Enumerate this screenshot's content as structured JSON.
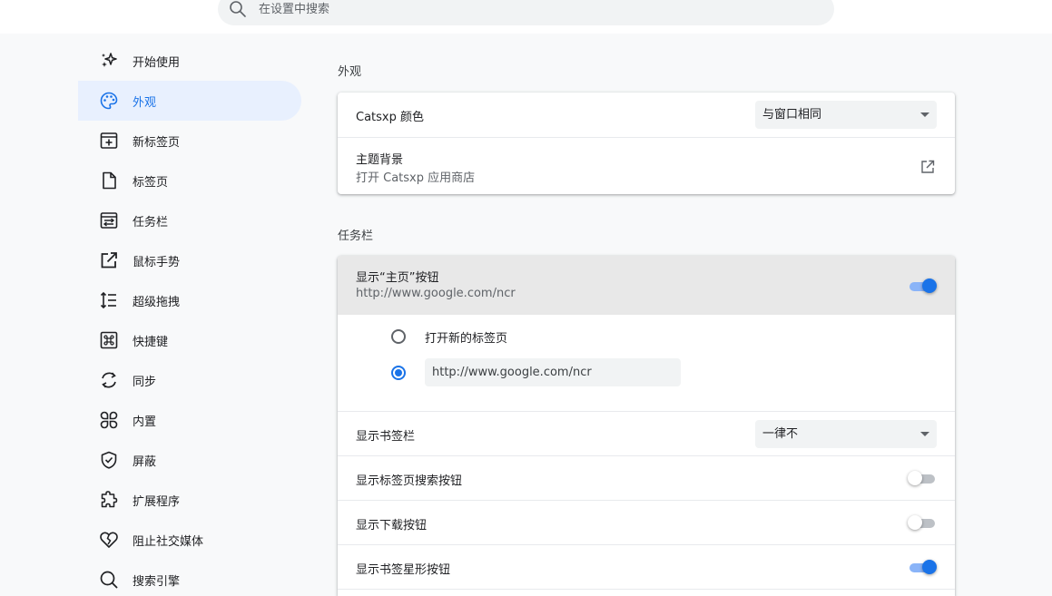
{
  "search": {
    "placeholder": "在设置中搜索"
  },
  "sidebar": {
    "items": [
      {
        "label": "开始使用",
        "icon": "sparkle-icon"
      },
      {
        "label": "外观",
        "icon": "palette-icon"
      },
      {
        "label": "新标签页",
        "icon": "new-tab-icon"
      },
      {
        "label": "标签页",
        "icon": "tab-page-icon"
      },
      {
        "label": "任务栏",
        "icon": "toolbar-icon"
      },
      {
        "label": "鼠标手势",
        "icon": "mouse-gesture-icon"
      },
      {
        "label": "超级拖拽",
        "icon": "super-drag-icon"
      },
      {
        "label": "快捷键",
        "icon": "shortcut-icon"
      },
      {
        "label": "同步",
        "icon": "sync-icon"
      },
      {
        "label": "内置",
        "icon": "builtin-icon"
      },
      {
        "label": "屏蔽",
        "icon": "shield-icon"
      },
      {
        "label": "扩展程序",
        "icon": "extension-icon"
      },
      {
        "label": "阻止社交媒体",
        "icon": "broken-heart-icon"
      },
      {
        "label": "搜索引擎",
        "icon": "search-icon"
      }
    ],
    "active_index": 1
  },
  "appearance": {
    "title": "外观",
    "color_label": "Catsxp 颜色",
    "color_value": "与窗口相同",
    "theme_label": "主题背景",
    "theme_sub": "打开 Catsxp 应用商店"
  },
  "toolbar": {
    "title": "任务栏",
    "home_label": "显示“主页”按钮",
    "home_sub": "http://www.google.com/ncr",
    "home_enabled": true,
    "radio_new_tab": "打开新的标签页",
    "radio_url_value": "http://www.google.com/ncr",
    "bookmarks_bar_label": "显示书签栏",
    "bookmarks_bar_value": "一律不",
    "tab_search_label": "显示标签页搜索按钮",
    "tab_search_enabled": false,
    "download_label": "显示下载按钮",
    "download_enabled": false,
    "bookmark_star_label": "显示书签星形按钮",
    "bookmark_star_enabled": true
  },
  "colors": {
    "accent": "#1a73e8",
    "active_nav_bg": "#e8f0fe",
    "highlight_row_bg": "#e8e8e8"
  }
}
